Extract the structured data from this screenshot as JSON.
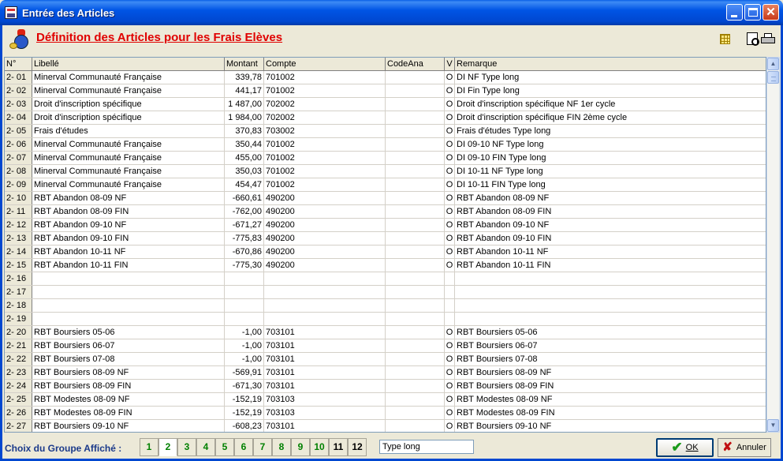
{
  "window": {
    "title": "Entrée des Articles"
  },
  "header": {
    "title": "Définition des Articles pour les Frais Elèves"
  },
  "table": {
    "columns": [
      "N°",
      "Libellé",
      "Montant",
      "Compte",
      "CodeAna",
      "V",
      "Remarque"
    ],
    "rows": [
      {
        "no": "2- 01",
        "lib": "Minerval Communauté Française",
        "mt": "339,78",
        "cp": "701002",
        "ca": "",
        "v": "O",
        "rm": "DI NF Type long"
      },
      {
        "no": "2- 02",
        "lib": "Minerval Communauté Française",
        "mt": "441,17",
        "cp": "701002",
        "ca": "",
        "v": "O",
        "rm": "DI Fin Type long"
      },
      {
        "no": "2- 03",
        "lib": "Droit d'inscription spécifique",
        "mt": "1 487,00",
        "cp": "702002",
        "ca": "",
        "v": "O",
        "rm": "Droit d'inscription spécifique NF 1er cycle"
      },
      {
        "no": "2- 04",
        "lib": "Droit d'inscription spécifique",
        "mt": "1 984,00",
        "cp": "702002",
        "ca": "",
        "v": "O",
        "rm": "Droit d'inscription spécifique FIN 2ème cycle"
      },
      {
        "no": "2- 05",
        "lib": "Frais d'études",
        "mt": "370,83",
        "cp": "703002",
        "ca": "",
        "v": "O",
        "rm": "Frais d'études Type long"
      },
      {
        "no": "2- 06",
        "lib": "Minerval Communauté Française",
        "mt": "350,44",
        "cp": "701002",
        "ca": "",
        "v": "O",
        "rm": "DI 09-10 NF Type long"
      },
      {
        "no": "2- 07",
        "lib": "Minerval Communauté Française",
        "mt": "455,00",
        "cp": "701002",
        "ca": "",
        "v": "O",
        "rm": "DI 09-10 FIN Type long"
      },
      {
        "no": "2- 08",
        "lib": "Minerval Communauté Française",
        "mt": "350,03",
        "cp": "701002",
        "ca": "",
        "v": "O",
        "rm": "DI 10-11 NF Type long"
      },
      {
        "no": "2- 09",
        "lib": "Minerval Communauté Française",
        "mt": "454,47",
        "cp": "701002",
        "ca": "",
        "v": "O",
        "rm": "DI 10-11 FIN Type long"
      },
      {
        "no": "2- 10",
        "lib": "RBT Abandon 08-09 NF",
        "mt": "-660,61",
        "cp": "490200",
        "ca": "",
        "v": "O",
        "rm": "RBT Abandon 08-09 NF"
      },
      {
        "no": "2- 11",
        "lib": "RBT Abandon 08-09 FIN",
        "mt": "-762,00",
        "cp": "490200",
        "ca": "",
        "v": "O",
        "rm": "RBT Abandon 08-09 FIN"
      },
      {
        "no": "2- 12",
        "lib": "RBT Abandon 09-10 NF",
        "mt": "-671,27",
        "cp": "490200",
        "ca": "",
        "v": "O",
        "rm": "RBT Abandon 09-10 NF"
      },
      {
        "no": "2- 13",
        "lib": "RBT Abandon 09-10 FIN",
        "mt": "-775,83",
        "cp": "490200",
        "ca": "",
        "v": "O",
        "rm": "RBT Abandon 09-10 FIN"
      },
      {
        "no": "2- 14",
        "lib": "RBT Abandon 10-11 NF",
        "mt": "-670,86",
        "cp": "490200",
        "ca": "",
        "v": "O",
        "rm": "RBT Abandon 10-11 NF"
      },
      {
        "no": "2- 15",
        "lib": "RBT Abandon 10-11 FIN",
        "mt": "-775,30",
        "cp": "490200",
        "ca": "",
        "v": "O",
        "rm": "RBT Abandon 10-11 FIN"
      },
      {
        "no": "2- 16",
        "lib": "",
        "mt": "",
        "cp": "",
        "ca": "",
        "v": "",
        "rm": ""
      },
      {
        "no": "2- 17",
        "lib": "",
        "mt": "",
        "cp": "",
        "ca": "",
        "v": "",
        "rm": ""
      },
      {
        "no": "2- 18",
        "lib": "",
        "mt": "",
        "cp": "",
        "ca": "",
        "v": "",
        "rm": ""
      },
      {
        "no": "2- 19",
        "lib": "",
        "mt": "",
        "cp": "",
        "ca": "",
        "v": "",
        "rm": ""
      },
      {
        "no": "2- 20",
        "lib": "RBT Boursiers 05-06",
        "mt": "-1,00",
        "cp": "703101",
        "ca": "",
        "v": "O",
        "rm": "RBT Boursiers 05-06"
      },
      {
        "no": "2- 21",
        "lib": "RBT Boursiers 06-07",
        "mt": "-1,00",
        "cp": "703101",
        "ca": "",
        "v": "O",
        "rm": "RBT Boursiers 06-07"
      },
      {
        "no": "2- 22",
        "lib": "RBT Boursiers 07-08",
        "mt": "-1,00",
        "cp": "703101",
        "ca": "",
        "v": "O",
        "rm": "RBT Boursiers 07-08"
      },
      {
        "no": "2- 23",
        "lib": "RBT Boursiers 08-09 NF",
        "mt": "-569,91",
        "cp": "703101",
        "ca": "",
        "v": "O",
        "rm": "RBT Boursiers 08-09 NF"
      },
      {
        "no": "2- 24",
        "lib": "RBT Boursiers 08-09 FIN",
        "mt": "-671,30",
        "cp": "703101",
        "ca": "",
        "v": "O",
        "rm": "RBT Boursiers 08-09 FIN"
      },
      {
        "no": "2- 25",
        "lib": "RBT Modestes 08-09 NF",
        "mt": "-152,19",
        "cp": "703103",
        "ca": "",
        "v": "O",
        "rm": "RBT Modestes 08-09 NF"
      },
      {
        "no": "2- 26",
        "lib": "RBT Modestes 08-09 FIN",
        "mt": "-152,19",
        "cp": "703103",
        "ca": "",
        "v": "O",
        "rm": "RBT Modestes 08-09 FIN"
      },
      {
        "no": "2- 27",
        "lib": "RBT Boursiers 09-10 NF",
        "mt": "-608,23",
        "cp": "703101",
        "ca": "",
        "v": "O",
        "rm": "RBT Boursiers 09-10 NF"
      }
    ]
  },
  "footer": {
    "group_label": "Choix du Groupe Affiché :",
    "groups": [
      "1",
      "2",
      "3",
      "4",
      "5",
      "6",
      "7",
      "8",
      "9",
      "10",
      "11",
      "12"
    ],
    "active_group": "2",
    "filter_value": "Type long",
    "ok_label": "OK",
    "cancel_label": "Annuler"
  },
  "colors": {
    "heading": "#e00000",
    "group_text": "#008000",
    "titlebar": "#0055e5"
  }
}
